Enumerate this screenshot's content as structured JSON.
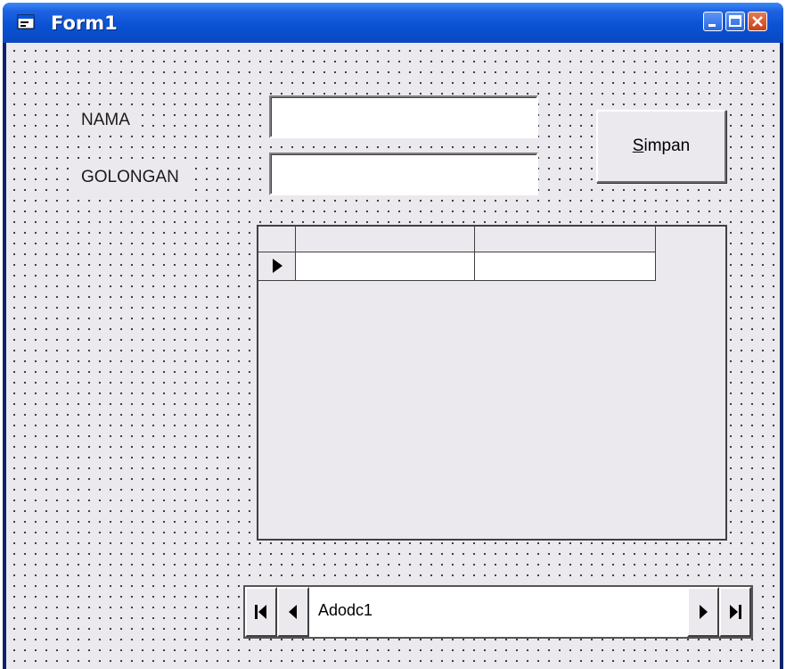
{
  "window": {
    "title": "Form1"
  },
  "form": {
    "labels": {
      "nama": "NAMA",
      "golongan": "GOLONGAN"
    },
    "nama_value": "",
    "golongan_value": "",
    "save_button": {
      "mnemonic": "S",
      "rest": "impan"
    }
  },
  "grid": {
    "columns": [
      "",
      ""
    ],
    "rows": [
      [
        "",
        ""
      ]
    ]
  },
  "adodc": {
    "caption": "Adodc1"
  },
  "icons": [
    "form-icon",
    "minimize-icon",
    "maximize-icon",
    "close-icon",
    "row-selector-icon",
    "first-record-icon",
    "previous-record-icon",
    "next-record-icon",
    "last-record-icon"
  ]
}
